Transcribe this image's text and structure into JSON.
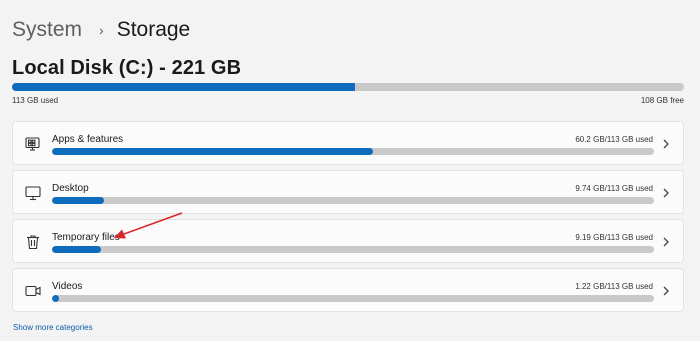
{
  "breadcrumb": {
    "parent": "System",
    "separator": "›",
    "current": "Storage"
  },
  "disk": {
    "title": "Local Disk (C:) - 221 GB",
    "used_label": "113 GB used",
    "free_label": "108 GB free",
    "used_fraction": 0.511
  },
  "categories": [
    {
      "label": "Apps & features",
      "size": "60.2 GB/113 GB used",
      "fraction": 0.533,
      "icon": "apps-features-icon"
    },
    {
      "label": "Desktop",
      "size": "9.74 GB/113 GB used",
      "fraction": 0.086,
      "icon": "desktop-icon"
    },
    {
      "label": "Temporary files",
      "size": "9.19 GB/113 GB used",
      "fraction": 0.081,
      "icon": "trash-icon"
    },
    {
      "label": "Videos",
      "size": "1.22 GB/113 GB used",
      "fraction": 0.011,
      "icon": "video-icon"
    }
  ],
  "show_more": "Show more categories",
  "colors": {
    "accent": "#0f6cbd",
    "track": "#c9c9c9",
    "annotation_arrow": "#d8262b"
  }
}
